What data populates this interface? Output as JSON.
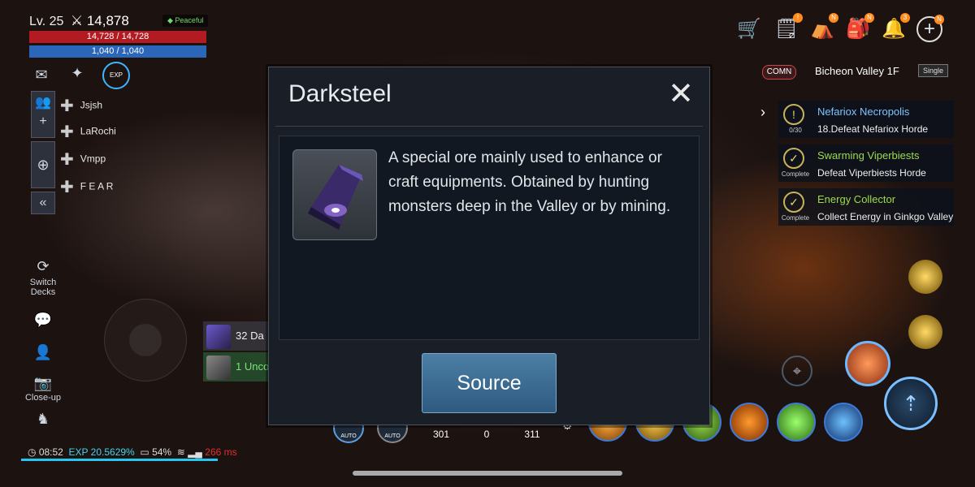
{
  "player": {
    "level": "Lv. 25",
    "combat_power": "14,878",
    "status": "Peaceful",
    "hp": "14,728 / 14,728",
    "mp": "1,040 / 1,040",
    "exp_buff": "EXP"
  },
  "party": [
    "Jsjsh",
    "LaRochi",
    "Vmpp",
    "F E A R"
  ],
  "left_menu": {
    "switch_decks": "Switch Decks",
    "close_up": "Close-up"
  },
  "top_icons": [
    "cart-icon",
    "quest-scroll-icon",
    "guild-icon",
    "inventory-icon",
    "bell-icon",
    "plus-icon"
  ],
  "top_badges": [
    "!",
    "!",
    "N",
    "N",
    "3",
    "N"
  ],
  "location": {
    "channel": "COMN",
    "name": "Bicheon Valley 1F",
    "mode": "Single"
  },
  "quests": [
    {
      "title": "Nefariox Necropolis",
      "desc": "18.Defeat Nefariox Horde",
      "status": "0/30",
      "title_color": "#7fc4ff"
    },
    {
      "title": "Swarming Viperbiests",
      "desc": "Defeat Viperbiests Horde",
      "status": "Complete",
      "title_color": "#9bdc4e"
    },
    {
      "title": "Energy Collector",
      "desc": "Collect Energy in Ginkgo Valley",
      "status": "Complete",
      "title_color": "#9bdc4e"
    }
  ],
  "dialog": {
    "title": "Darksteel",
    "description": "A special ore mainly used to enhance or craft equipments. Obtained by hunting monsters deep in the Valley or by mining.",
    "button": "Source"
  },
  "loot": [
    {
      "text": "32 Da"
    },
    {
      "text": "1 Unco"
    }
  ],
  "potions": [
    "301",
    "0",
    "311"
  ],
  "auto_labels": [
    "AUTO",
    "AUTO"
  ],
  "status_bar": {
    "time": "08:52",
    "exp": "EXP 20.5629%",
    "battery": "54%",
    "ping": "266 ms"
  }
}
